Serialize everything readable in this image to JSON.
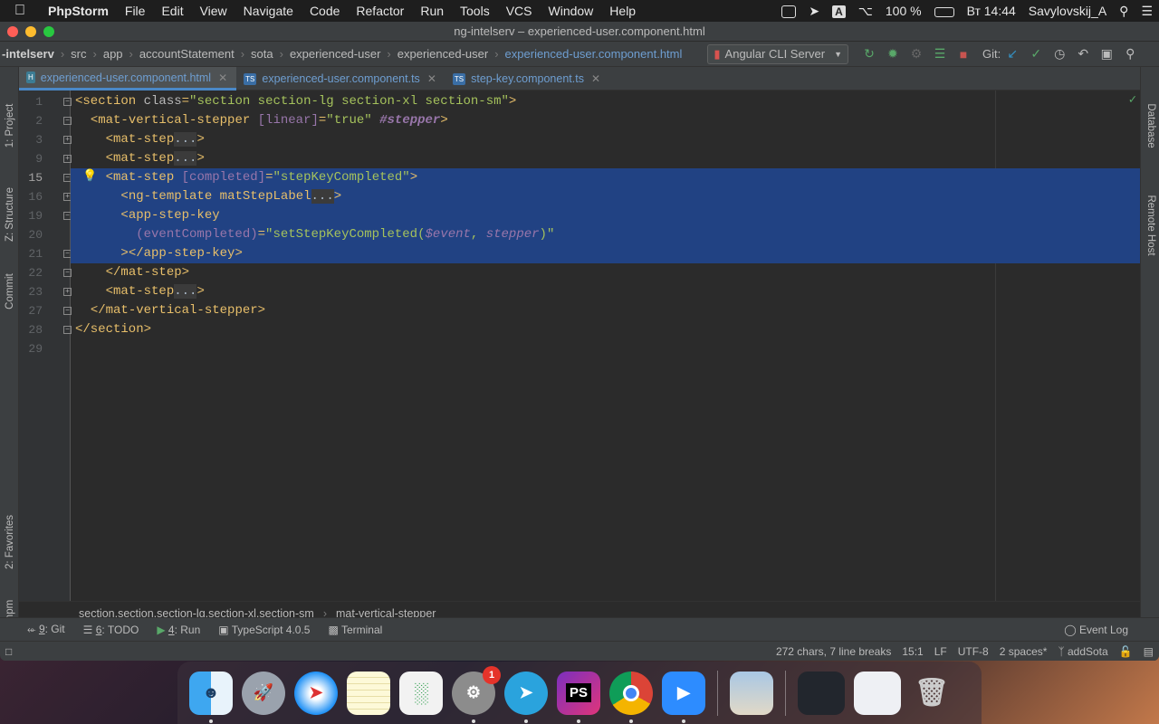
{
  "menubar": {
    "items": [
      "PhpStorm",
      "File",
      "Edit",
      "View",
      "Navigate",
      "Code",
      "Refactor",
      "Run",
      "Tools",
      "VCS",
      "Window",
      "Help"
    ],
    "battery": "100 %",
    "clock": "Вт 14:44",
    "user": "Savylovskij_A"
  },
  "window": {
    "title": "ng-intelserv – experienced-user.component.html"
  },
  "navbar": {
    "crumbs": [
      "-intelserv",
      "src",
      "app",
      "accountStatement",
      "sota",
      "experienced-user",
      "experienced-user",
      "experienced-user.component.html"
    ],
    "run_config": "Angular CLI Server",
    "git_label": "Git:"
  },
  "left_tool_tabs": [
    "1: Project",
    "Z: Structure",
    "Commit",
    "2: Favorites",
    "npm"
  ],
  "right_tool_tabs": [
    "Database",
    "Remote Host"
  ],
  "tabs": [
    {
      "label": "experienced-user.component.html",
      "type": "html",
      "active": true
    },
    {
      "label": "experienced-user.component.ts",
      "type": "ts",
      "active": false
    },
    {
      "label": "step-key.component.ts",
      "type": "ts",
      "active": false
    }
  ],
  "editor": {
    "line_numbers": [
      "1",
      "2",
      "3",
      "9",
      "15",
      "16",
      "19",
      "20",
      "21",
      "22",
      "23",
      "27",
      "28",
      "29"
    ],
    "current_line": "15",
    "code_lines": [
      "<section class=\"section section-lg section-xl section-sm\">",
      "  <mat-vertical-stepper [linear]=\"true\" #stepper>",
      "    <mat-step...>",
      "    <mat-step...>",
      "    <mat-step [completed]=\"stepKeyCompleted\">",
      "      <ng-template matStepLabel...>",
      "      <app-step-key",
      "        (eventCompleted)=\"setStepKeyCompleted($event, stepper)\"",
      "      ></app-step-key>",
      "    </mat-step>",
      "    <mat-step...>",
      "  </mat-vertical-stepper>",
      "</section>",
      ""
    ]
  },
  "breadcrumbs": [
    "section.section.section-lg.section-xl.section-sm",
    "mat-vertical-stepper"
  ],
  "tool_windows": [
    {
      "num": "9",
      "label": ": Git"
    },
    {
      "num": "6",
      "label": ": TODO"
    },
    {
      "num": "4",
      "label": ": Run"
    },
    {
      "num": "",
      "label": "TypeScript 4.0.5"
    },
    {
      "num": "",
      "label": "Terminal"
    }
  ],
  "event_log": "Event Log",
  "status": {
    "chars": "272 chars, 7 line breaks",
    "position": "15:1",
    "line_sep": "LF",
    "encoding": "UTF-8",
    "indent": "2 spaces*",
    "branch": "addSota"
  },
  "dock": {
    "apps": [
      "Finder",
      "Launchpad",
      "Safari",
      "Notes",
      "Numbers",
      "System Preferences",
      "Telegram",
      "PhpStorm",
      "Chrome",
      "Zoom",
      "Preview",
      "Window 1",
      "Window 2",
      "Trash"
    ],
    "sysprefs_badge": "1",
    "phpstorm_icon_text": "PS"
  }
}
